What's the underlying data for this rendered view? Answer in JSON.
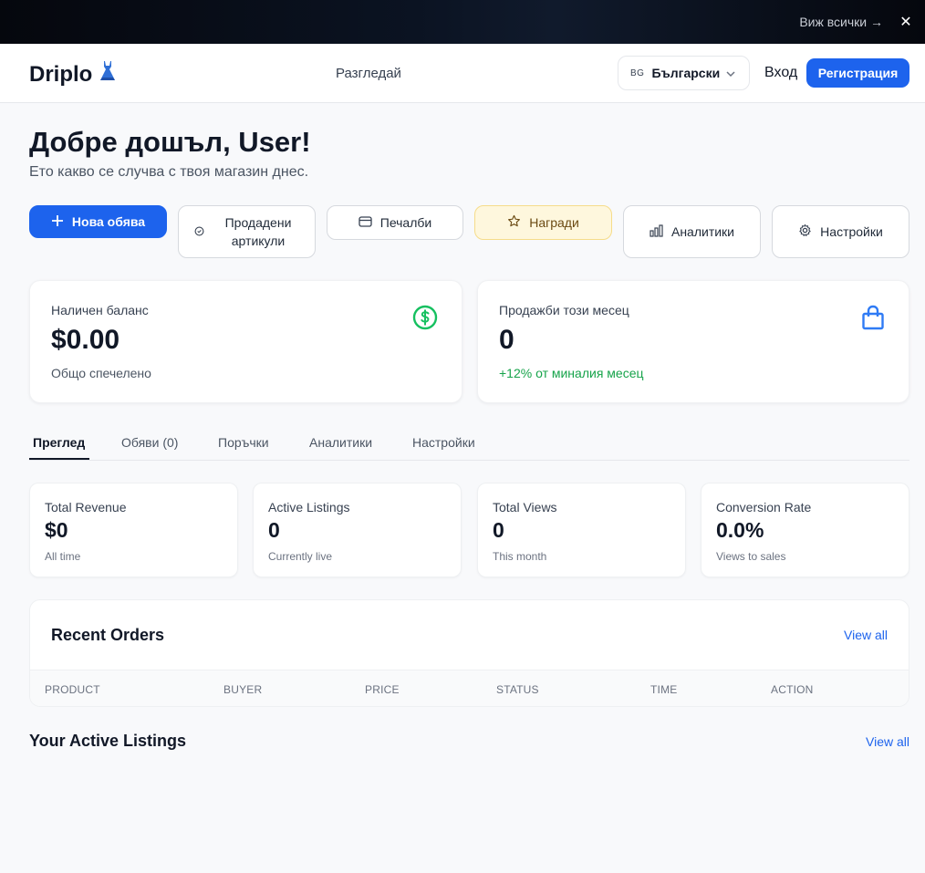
{
  "banner": {
    "view_all": "Виж всички →",
    "close": "✕"
  },
  "header": {
    "logo": "Driplo",
    "browse": "Разгледай",
    "language": {
      "code": "BG",
      "name": "Български"
    },
    "login": "Вход",
    "register": "Регистрация"
  },
  "greeting": {
    "title": "Добре дошъл, User!",
    "subtitle": "Ето какво се случва с твоя магазин днес."
  },
  "actions": {
    "new_listing": "Нова обява",
    "sold_items": "Продадени артикули",
    "earnings": "Печалби",
    "rewards": "Награди",
    "analytics": "Аналитики",
    "settings": "Настройки"
  },
  "balance_card": {
    "label": "Наличен баланс",
    "value": "$0.00",
    "sub": "Общо спечелено",
    "icon": "dollar-circle-icon",
    "icon_color": "#16c060"
  },
  "sales_card": {
    "label": "Продажби този месец",
    "value": "0",
    "sub": "+12% от миналия месец",
    "icon": "shopping-bag-icon",
    "icon_color": "#2f7bf5"
  },
  "tabs": [
    "Преглед",
    "Обяви (0)",
    "Поръчки",
    "Аналитики",
    "Настройки"
  ],
  "stats": [
    {
      "label": "Total Revenue",
      "value": "$0",
      "sub": "All time"
    },
    {
      "label": "Active Listings",
      "value": "0",
      "sub": "Currently live"
    },
    {
      "label": "Total Views",
      "value": "0",
      "sub": "This month"
    },
    {
      "label": "Conversion Rate",
      "value": "0.0%",
      "sub": "Views to sales"
    }
  ],
  "orders": {
    "title": "Recent Orders",
    "view_all": "View all",
    "columns": [
      "PRODUCT",
      "BUYER",
      "PRICE",
      "STATUS",
      "TIME",
      "ACTION"
    ]
  },
  "listings": {
    "title": "Your Active Listings",
    "view_all": "View all"
  },
  "colors": {
    "primary": "#1d63ed",
    "success": "#16a34a"
  }
}
